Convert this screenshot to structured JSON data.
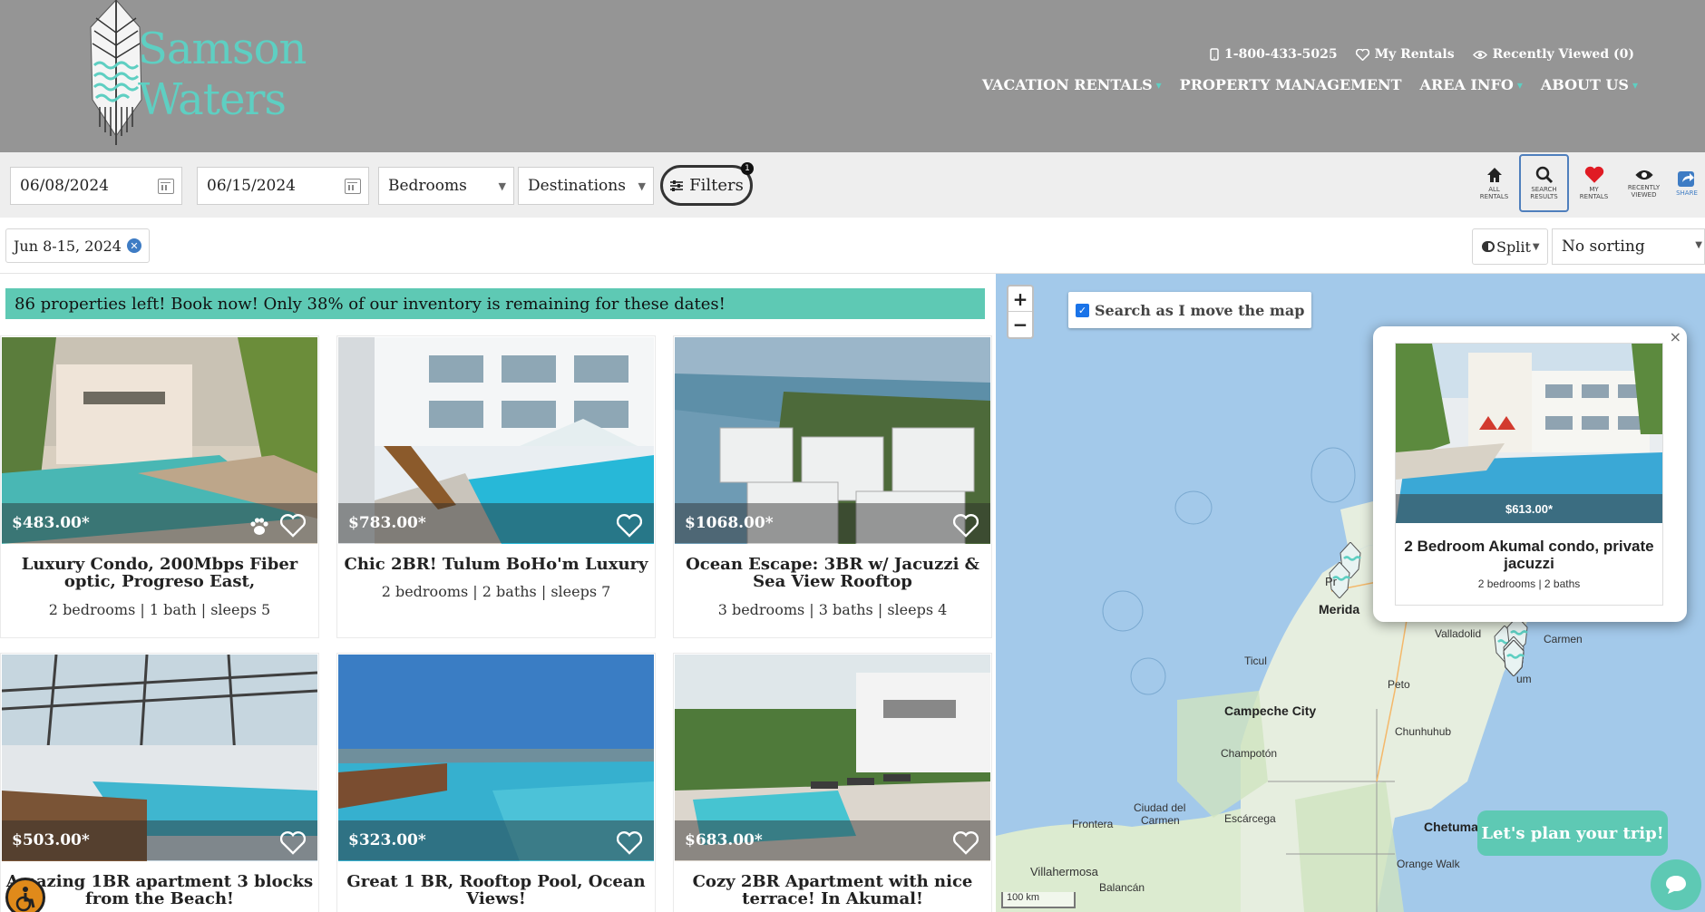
{
  "brand": {
    "name_line1": "Samson",
    "name_line2": "Waters",
    "accent": "#5ecfc2"
  },
  "topbar": {
    "phone": "1-800-433-5025",
    "my_rentals": "My Rentals",
    "recently_viewed": "Recently Viewed (0)"
  },
  "nav": {
    "items": [
      "VACATION RENTALS",
      "PROPERTY MANAGEMENT",
      "AREA INFO",
      "ABOUT US"
    ]
  },
  "search": {
    "checkin": "06/08/2024",
    "checkout": "06/15/2024",
    "bedrooms": "Bedrooms",
    "destinations": "Destinations",
    "filters_label": "Filters",
    "filters_count": "1"
  },
  "tools": [
    {
      "icon": "home-icon",
      "label_1": "ALL",
      "label_2": "RENTALS"
    },
    {
      "icon": "search-icon",
      "label_1": "SEARCH",
      "label_2": "RESULTS"
    },
    {
      "icon": "heart-icon",
      "label_1": "MY",
      "label_2": "RENTALS"
    },
    {
      "icon": "eye-icon",
      "label_1": "RECENTLY",
      "label_2": "VIEWED"
    },
    {
      "icon": "share-icon",
      "label_1": "SHARE",
      "label_2": ""
    }
  ],
  "chips": {
    "date_range": "Jun 8-15, 2024"
  },
  "view": {
    "split_label": "Split",
    "sorting": "No sorting"
  },
  "banner": "86 properties left! Book now! Only 38% of our inventory is remaining for these dates!",
  "listings": [
    {
      "price": "$483.00*",
      "title": "Luxury Condo, 200Mbps Fiber optic, Progreso East,",
      "meta": "2 bedrooms | 1 bath | sleeps 5",
      "pet_friendly": true
    },
    {
      "price": "$783.00*",
      "title": "Chic 2BR! Tulum BoHo'm Luxury",
      "meta": "2 bedrooms | 2 baths | sleeps 7",
      "pet_friendly": false
    },
    {
      "price": "$1068.00*",
      "title": "Ocean Escape: 3BR w/ Jacuzzi & Sea View Rooftop",
      "meta": "3 bedrooms | 3 baths | sleeps 4",
      "pet_friendly": false
    },
    {
      "price": "$503.00*",
      "title": "Amazing 1BR apartment 3 blocks from the Beach!",
      "meta": "",
      "pet_friendly": false
    },
    {
      "price": "$323.00*",
      "title": "Great 1 BR, Rooftop Pool, Ocean Views!",
      "meta": "",
      "pet_friendly": false
    },
    {
      "price": "$683.00*",
      "title": "Cozy 2BR Apartment with nice terrace! In Akumal!",
      "meta": "",
      "pet_friendly": false
    }
  ],
  "map": {
    "zoom_in": "+",
    "zoom_out": "−",
    "search_as_move": "Search as I move the map",
    "scale": "100 km",
    "popup": {
      "price": "$613.00*",
      "title": "2 Bedroom Akumal condo, private jacuzzi",
      "meta": "2 bedrooms | 2 baths",
      "close": "×"
    },
    "places": {
      "merida": "Merida",
      "valladolid": "Valladolid",
      "carmen": "Carmen",
      "ticul": "Ticul",
      "peto": "Peto",
      "campeche": "Campeche City",
      "chunhuhub": "Chunhuhub",
      "champoton": "Champotón",
      "ciudad_del_carmen_1": "Ciudad del",
      "ciudad_del_carmen_2": "Carmen",
      "escarcega": "Escárcega",
      "frontera": "Frontera",
      "chetumal": "Chetumal",
      "orange_walk": "Orange Walk",
      "villahermosa": "Villahermosa",
      "balancan": "Balancán",
      "progreso_fragment": "Pr",
      "tulum_fragment": "um"
    }
  },
  "chat": {
    "plan_label": "Let's plan your trip!"
  }
}
